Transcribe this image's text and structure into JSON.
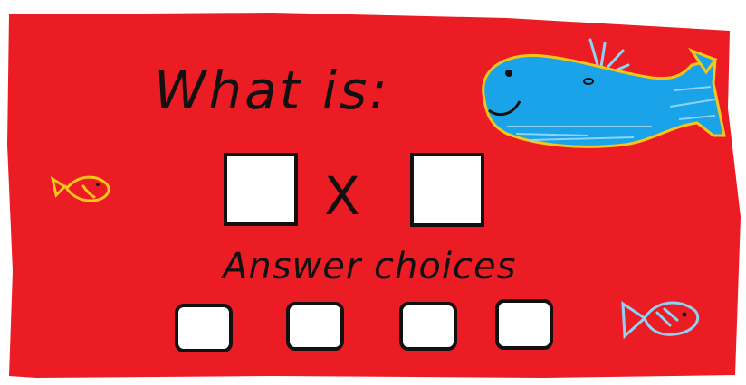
{
  "card": {
    "background_color": "#ec1c24",
    "outline_color": "#111111"
  },
  "question": {
    "label": "What is:",
    "operator": "X",
    "operand_box_left": "",
    "operand_box_right": ""
  },
  "answers": {
    "label": "Answer choices",
    "choices": [
      "",
      "",
      "",
      ""
    ]
  },
  "decorations": {
    "whale_icon": "whale-icon",
    "whale_color": "#1aa3e8",
    "whale_outline": "#f5c518",
    "fish_left_icon": "fish-icon",
    "fish_left_color": "#f5c518",
    "fish_right_icon": "fish-icon",
    "fish_right_color": "#8fd3f4"
  }
}
